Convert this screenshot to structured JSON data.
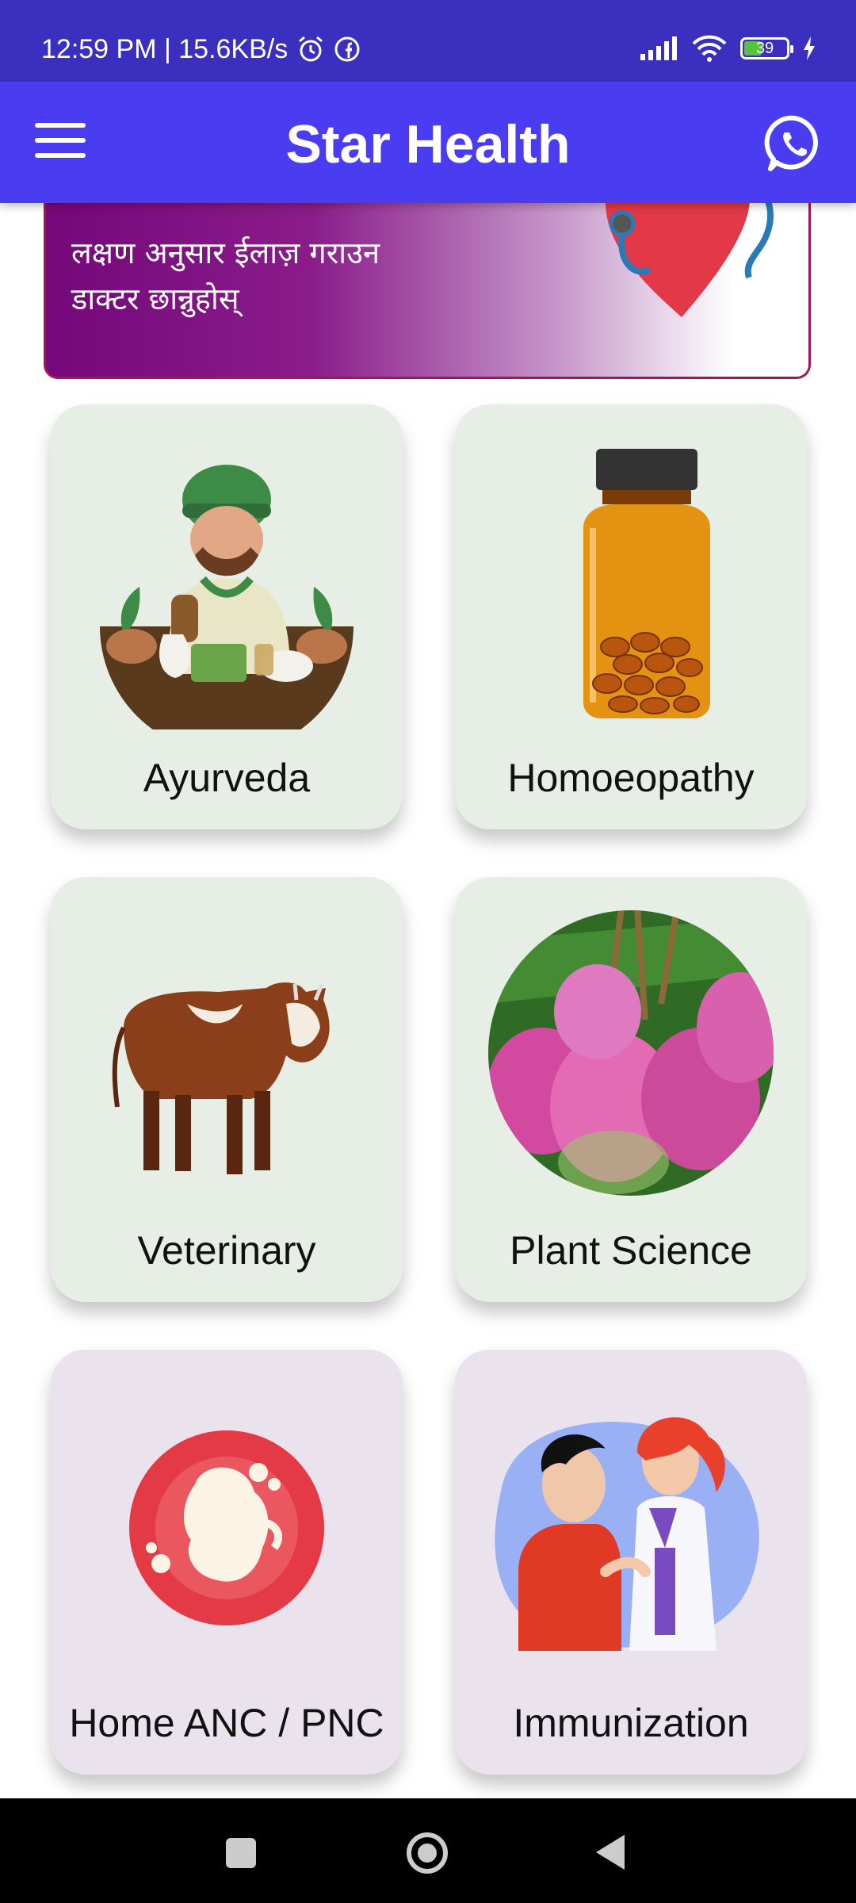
{
  "status_bar": {
    "time_speed": "12:59 PM | 15.6KB/s",
    "battery": "39",
    "alarm_icon": "alarm-icon",
    "facebook_icon": "facebook-icon",
    "signal_icon": "signal-icon",
    "wifi_icon": "wifi-icon",
    "charging_icon": "charging-icon",
    "battery_fill_fraction": 0.39,
    "battery_color": "#58c33a"
  },
  "app_bar": {
    "title": "Star Health",
    "menu_icon": "hamburger-menu-icon",
    "whatsapp_icon": "whatsapp-icon",
    "color": "#4a3cf0"
  },
  "banner": {
    "line1": "लक्षण अनुसार ईलाज़ गराउन",
    "line2": "डाक्टर छान्नुहोस्",
    "image_icon": "heart-stethoscope-image"
  },
  "cards": [
    {
      "label": "Ayurveda",
      "image": "ayurveda-herbalist-image"
    },
    {
      "label": "Homoeopathy",
      "image": "medicine-bottle-image"
    },
    {
      "label": "Veterinary",
      "image": "cow-image"
    },
    {
      "label": "Plant Science",
      "image": "fruits-on-tree-image"
    },
    {
      "label": "Home ANC / PNC",
      "image": "fetus-image"
    },
    {
      "label": "Immunization",
      "image": "doctor-vaccination-image"
    }
  ],
  "nav_bar": {
    "recents_icon": "recents-square-icon",
    "home_icon": "home-circle-icon",
    "back_icon": "back-triangle-icon"
  }
}
